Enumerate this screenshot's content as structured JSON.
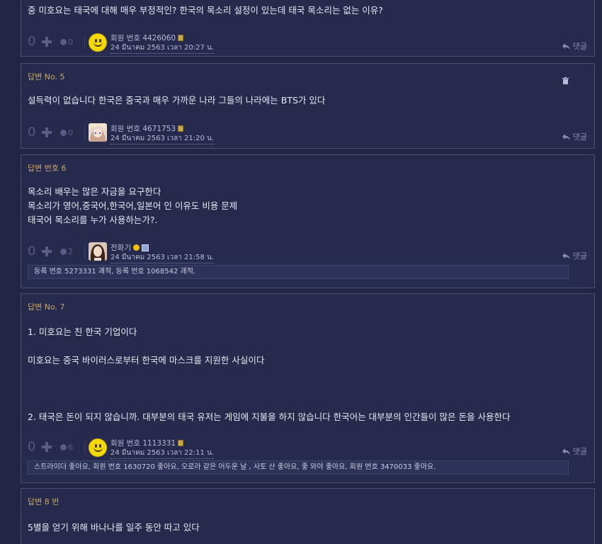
{
  "answers": [
    {
      "label": "",
      "body": "중 미호요는 태국에 대해 매우 부정적인? 한국의 목소리 설정이 있는데 태국 목소리는 없는 이유?",
      "likes": "0",
      "comments_count": "0",
      "avatar": "smiley",
      "user": "회원 번호 4426060",
      "date": "24 มีนาคม 2563 เวลา 20:27 น.",
      "reply": "댓글"
    },
    {
      "label": "답변 No. 5",
      "body": "설득력이 없습니다 한국은 중국과 매우 가까운 나라 그들의 나라에는 BTS가 있다",
      "likes": "0",
      "comments_count": "0",
      "avatar": "anime-photo",
      "user": "회원 번호 4671753",
      "date": "24 มีนาคม 2563 เวลา 21:20 น.",
      "reply": "댓글",
      "has_trash": true
    },
    {
      "label": "답변 번호 6",
      "body": "목소리 배우는 많은 자금을 요구한다\n목소리가 영어,중국어,한국어,일본어 인 이유도 비용 문제\n태국어 목소리를 누가 사용하는가?.",
      "likes": "0",
      "comments_count": "2",
      "avatar": "portrait-photo",
      "user": "전화기",
      "date": "24 มีนาคม 2563 เวลา 21:58 น.",
      "reply": "댓글",
      "comment_text": "등록 번호 5273331 괘적, 등록 번호 1068542 괘적."
    },
    {
      "label": "답변 No. 7",
      "body": "1. 미호요는 친 한국 기업이다\n\n미호요는 중국 바이러스로부터 한국에 마스크를 지원한 사실이다\n\n\n\n2. 태국은 돈이 되지 않습니까. 대부분의 태국 유저는 게임에 지불을 하지 않습니다 한국어는 대부분의 인간들이 많은 돈을 사용한다",
      "likes": "0",
      "comments_count": "6",
      "avatar": "smiley",
      "user": "회원 번호 1113331",
      "date": "24 มีนาคม 2563 เวลา 22:11 น.",
      "reply": "댓글",
      "comment_text": "스트라이더 좋아요, 회원 번호 1630720 좋아요, 오로라 같은 어두운 날 , 사토 산 좋아요, 좋 와야 좋아요, 회원 번호 3470033 좋아요."
    },
    {
      "label": "답변 8 번",
      "body": "5별을 얻기 위해 바나나를 일주 동안 따고 있다"
    }
  ],
  "colors": {
    "background": "#232545",
    "card": "#262a4d",
    "border": "#4a4e78",
    "label": "#c9a66b",
    "text": "#e8e9f2"
  }
}
